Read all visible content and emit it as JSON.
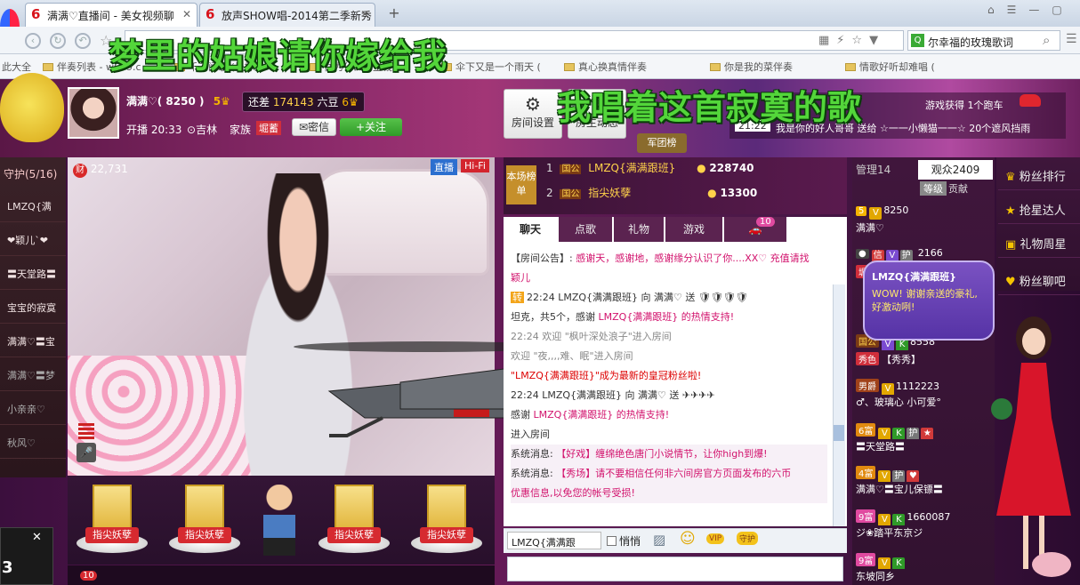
{
  "browser": {
    "tabs": [
      {
        "title": "满满♡直播间 - 美女视频聊"
      },
      {
        "title": "放声SHOW唱-2014第二季新秀"
      }
    ],
    "search_text": "尔幸福的玫瑰歌词",
    "bookmarks": [
      "此大全",
      "伴奏列表 - w699.c",
      "千千阙歌 (最好的",
      "你为什么不上钱(",
      "伞下又是一个雨天 (",
      "真心换真情伴奏",
      "你是我的菜伴奏",
      "情歌好听却难唱 ("
    ]
  },
  "lyrics": {
    "line1": "梦里的姑娘请你嫁给我",
    "line2": "我唱着这首寂寞的歌"
  },
  "host": {
    "name": "满满♡",
    "id": "( 8250 )",
    "level_badge": "5",
    "huandou_label": "还差",
    "huandou_value": "174143",
    "liudou_label": "六豆",
    "open_time": "开播 20:33",
    "location": "吉林",
    "family_label": "家族",
    "family_badge": "堀蓄",
    "msg_label": "密信",
    "follow_label": "+关注"
  },
  "header_buttons": {
    "settings": "房间设置",
    "dynamic": "房主动态",
    "army": "军团榜"
  },
  "notice": {
    "time": "21:22",
    "text": "我是你的好人哥哥 送给 ☆一一小懒猫一一☆ 20个遮风挡雨",
    "text2": "游戏获得 1个跑车"
  },
  "guards": {
    "title": "守护(5/16)",
    "items": [
      "LMZQ{满",
      "❤颖儿`❤",
      "〓天堂路〓",
      "宝宝的寂寞",
      "满满♡〓宝",
      "满满♡〓梦",
      "小亲亲♡",
      "秋风♡"
    ]
  },
  "video": {
    "fans": "22,731",
    "live": "直播",
    "hifi": "Hi-Fi"
  },
  "gifts": [
    {
      "label": "指尖妖孽"
    },
    {
      "label": "指尖妖孽"
    },
    {
      "label": "指尖妖孽"
    },
    {
      "label": "指尖妖孽"
    }
  ],
  "rank": {
    "label": "本场榜单",
    "rows": [
      {
        "n": "1",
        "name": "LMZQ{满满跟班}",
        "val": "228740"
      },
      {
        "n": "2",
        "name": "指尖妖孽",
        "val": "13300"
      }
    ],
    "tag": "国公"
  },
  "chat": {
    "tabs": [
      "聊天",
      "点歌",
      "礼物",
      "游戏",
      "10"
    ],
    "lines": [
      {
        "a": "【房间公告】: ",
        "b": "感谢天，感谢地，感谢缘分认识了你....XX♡ 充值请找"
      },
      {
        "a": "",
        "b": "颖儿"
      },
      {
        "a": "22:24 LMZQ{满满跟班} 向 满满♡ 送",
        "b": ""
      },
      {
        "a": "坦克，共5个，感谢 ",
        "b": "LMZQ{满满跟班} 的热情支持!"
      },
      {
        "a": "22:24 欢迎 \"枫叶深处浪子\"进入房间",
        "b": ""
      },
      {
        "a": "欢迎 \"夜,,,,难、眠\"进入房间",
        "b": ""
      },
      {
        "a": "\"LMZQ{满满跟班}\"成为最新的皇冠粉丝啦!",
        "b": ""
      },
      {
        "a": "22:24 LMZQ{满满跟班} 向 满满♡ 送",
        "b": ""
      },
      {
        "a": "感谢 ",
        "b": "LMZQ{满满跟班} 的热情支持!"
      },
      {
        "a": "进入房间",
        "b": ""
      },
      {
        "a": "系统消息: ",
        "b": "【好戏】缠绵绝色唐门小说情节，让你high到爆!"
      },
      {
        "a": "系统消息: ",
        "b": "【秀场】请不要相信任何非六间房官方页面发布的六币"
      },
      {
        "a": "",
        "b": "优惠信息,以免您的帐号受损!"
      }
    ],
    "target": "LMZQ{满满跟",
    "whisper": "悄悄"
  },
  "audience": {
    "manage": "管理14",
    "viewers": "观众2409",
    "level_label": "等级",
    "contrib_label": "贡献",
    "rows": [
      {
        "badge": "5",
        "num": "8250",
        "name": "满满♡"
      },
      {
        "badge": "堀蓄",
        "num": "2166",
        "name": ""
      },
      {
        "badge": "国公",
        "num": "8558",
        "name": "【秀秀】"
      },
      {
        "badge": "男爵",
        "num": "1112223",
        "name": "♂、玻璃心 小可爱°"
      },
      {
        "badge": "6富",
        "num": "",
        "name": "〓天堂路〓"
      },
      {
        "badge": "4富",
        "num": "",
        "name": "满满♡〓宝儿保镖〓"
      },
      {
        "badge": "9富",
        "num": "1660087",
        "name": "ジ❀踏平东京ジ"
      },
      {
        "badge": "9富",
        "num": "",
        "name": "东坡同乡"
      }
    ]
  },
  "right_menu": [
    "粉丝排行",
    "抢星达人",
    "礼物周星",
    "粉丝聊吧"
  ],
  "bubble": {
    "name": "LMZQ{满满跟班}",
    "text": "WOW! 谢谢亲送的豪礼, 好激动咧!"
  },
  "colors": {
    "accent": "#d2136d",
    "lyric": "#53d63a"
  }
}
